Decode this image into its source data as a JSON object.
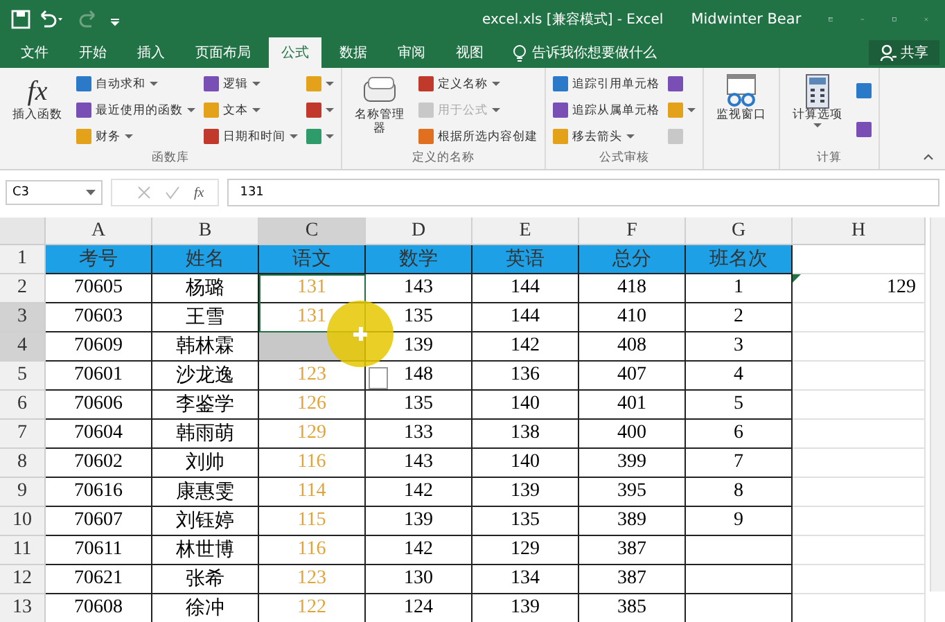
{
  "window": {
    "title": "excel.xls  [兼容模式]  -  Excel",
    "user": "Midwinter Bear"
  },
  "tabs": [
    {
      "label": "文件",
      "selected": false
    },
    {
      "label": "开始",
      "selected": false
    },
    {
      "label": "插入",
      "selected": false
    },
    {
      "label": "页面布局",
      "selected": false
    },
    {
      "label": "公式",
      "selected": true
    },
    {
      "label": "数据",
      "selected": false
    },
    {
      "label": "审阅",
      "selected": false
    },
    {
      "label": "视图",
      "selected": false
    }
  ],
  "tell_me": "告诉我你想要做什么",
  "share": "共享",
  "ribbon": [
    {
      "label": "函数库",
      "large": [
        {
          "label": "插入函数",
          "icon_text": "fx",
          "dropdown": false
        }
      ],
      "columns": [
        [
          {
            "label": "自动求和",
            "dropdown": true,
            "disabled": false
          },
          {
            "label": "最近使用的函数",
            "dropdown": true,
            "disabled": false
          },
          {
            "label": "财务",
            "dropdown": true,
            "disabled": false
          }
        ],
        [
          {
            "label": "逻辑",
            "dropdown": true,
            "disabled": false
          },
          {
            "label": "文本",
            "dropdown": true,
            "disabled": false
          },
          {
            "label": "日期和时间",
            "dropdown": true,
            "disabled": false
          }
        ],
        [
          {
            "dropdown": true,
            "disabled": false
          },
          {
            "dropdown": true,
            "disabled": false
          },
          {
            "dropdown": true,
            "disabled": false
          }
        ]
      ]
    },
    {
      "label": "定义的名称",
      "large": [
        {
          "label": "名称管理器",
          "dropdown": false
        }
      ],
      "columns": [
        [
          {
            "label": "定义名称",
            "dropdown": true,
            "disabled": false
          },
          {
            "label": "用于公式",
            "dropdown": true,
            "disabled": true
          },
          {
            "label": "根据所选内容创建",
            "dropdown": false,
            "disabled": false
          }
        ]
      ]
    },
    {
      "label": "公式审核",
      "columns": [
        [
          {
            "label": "追踪引用单元格",
            "dropdown": false,
            "disabled": false
          },
          {
            "label": "追踪从属单元格",
            "dropdown": false,
            "disabled": false
          },
          {
            "label": "移去箭头",
            "dropdown": true,
            "disabled": false
          }
        ],
        [
          {
            "dropdown": false,
            "disabled": false
          },
          {
            "dropdown": true,
            "disabled": false
          },
          {
            "dropdown": false,
            "disabled": true
          }
        ]
      ]
    },
    {
      "large": [
        {
          "label": "监视窗口",
          "dropdown": false
        }
      ]
    },
    {
      "label": "计算",
      "large": [
        {
          "label": "计算选项",
          "dropdown": true
        }
      ],
      "columns": [
        [
          {
            "dropdown": false,
            "disabled": false
          },
          {
            "dropdown": false,
            "disabled": false
          }
        ]
      ]
    }
  ],
  "formula_bar": {
    "name_box": "C3",
    "fx_button": "fx",
    "formula": "131"
  },
  "columns": [
    {
      "label": "A",
      "selected": false
    },
    {
      "label": "B",
      "selected": false
    },
    {
      "label": "C",
      "selected": true
    },
    {
      "label": "D",
      "selected": false
    },
    {
      "label": "E",
      "selected": false
    },
    {
      "label": "F",
      "selected": false
    },
    {
      "label": "G",
      "selected": false
    },
    {
      "label": "H",
      "selected": false
    }
  ],
  "rows": [
    {
      "number": "1",
      "selected": false,
      "kind": "header",
      "cells": [
        "考号",
        "姓名",
        "语文",
        "数学",
        "英语",
        "总分",
        "班名次",
        null
      ]
    },
    {
      "number": "2",
      "selected": false,
      "kind": "data",
      "cells": [
        "70605",
        "杨璐",
        "131",
        "143",
        "144",
        "418",
        "1",
        "129"
      ]
    },
    {
      "number": "3",
      "selected": true,
      "kind": "data",
      "cells": [
        "70603",
        "王雪",
        "131",
        "135",
        "144",
        "410",
        "2",
        null
      ]
    },
    {
      "number": "4",
      "selected": true,
      "kind": "data",
      "cells": [
        "70609",
        "韩林霖",
        null,
        "139",
        "142",
        "408",
        "3",
        null
      ]
    },
    {
      "number": "5",
      "selected": false,
      "kind": "data",
      "cells": [
        "70601",
        "沙龙逸",
        "123",
        "148",
        "136",
        "407",
        "4",
        null
      ]
    },
    {
      "number": "6",
      "selected": false,
      "kind": "data",
      "cells": [
        "70606",
        "李鉴学",
        "126",
        "135",
        "140",
        "401",
        "5",
        null
      ]
    },
    {
      "number": "7",
      "selected": false,
      "kind": "data",
      "cells": [
        "70604",
        "韩雨萌",
        "129",
        "133",
        "138",
        "400",
        "6",
        null
      ]
    },
    {
      "number": "8",
      "selected": false,
      "kind": "data",
      "cells": [
        "70602",
        "刘帅",
        "116",
        "143",
        "140",
        "399",
        "7",
        null
      ]
    },
    {
      "number": "9",
      "selected": false,
      "kind": "data",
      "cells": [
        "70616",
        "康惠雯",
        "114",
        "142",
        "139",
        "395",
        "8",
        null
      ]
    },
    {
      "number": "10",
      "selected": false,
      "kind": "data",
      "cells": [
        "70607",
        "刘钰婷",
        "115",
        "139",
        "135",
        "389",
        "9",
        null
      ]
    },
    {
      "number": "11",
      "selected": false,
      "kind": "data",
      "cells": [
        "70611",
        "林世博",
        "116",
        "142",
        "129",
        "387",
        null,
        null
      ]
    },
    {
      "number": "12",
      "selected": false,
      "kind": "data",
      "cells": [
        "70621",
        "张希",
        "123",
        "130",
        "134",
        "387",
        null,
        null
      ]
    },
    {
      "number": "13",
      "selected": false,
      "kind": "data",
      "cells": [
        "70608",
        "徐冲",
        "122",
        "124",
        "139",
        "385",
        null,
        null
      ]
    }
  ]
}
